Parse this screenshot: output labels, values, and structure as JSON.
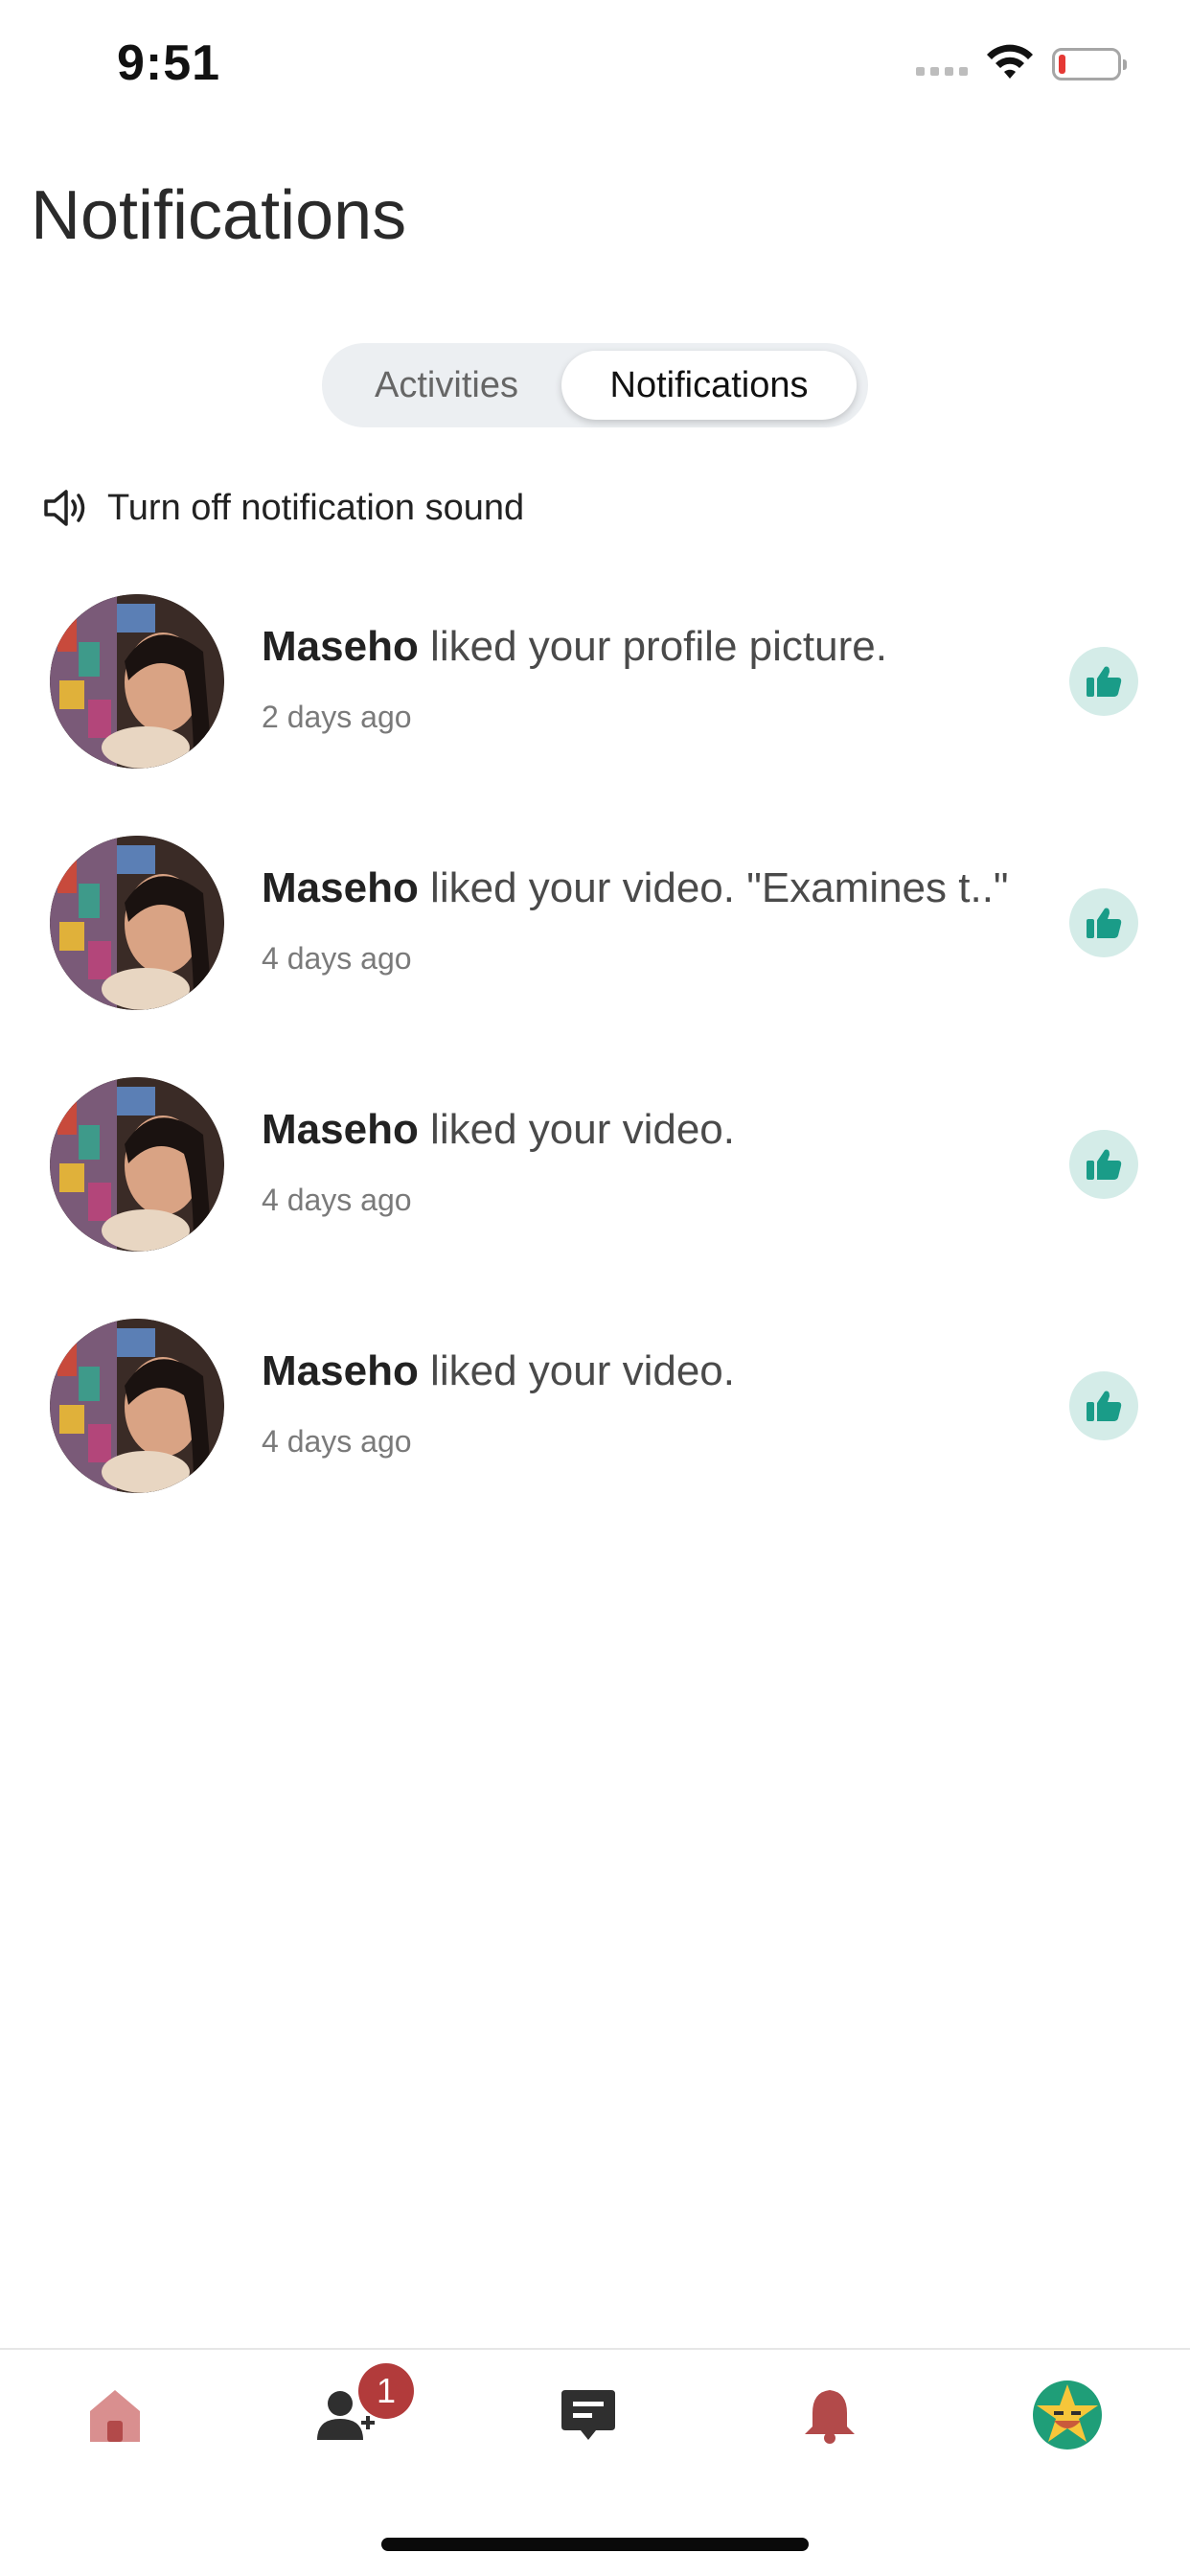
{
  "status_bar": {
    "time": "9:51",
    "battery_level": 0.12,
    "battery_color": "#e53935"
  },
  "header": {
    "title": "Notifications"
  },
  "tabs": {
    "items": [
      "Activities",
      "Notifications"
    ],
    "selected": "Notifications"
  },
  "sound_toggle": {
    "label": "Turn off notification sound",
    "icon": "speaker-icon"
  },
  "notifications": [
    {
      "name": "Maseho",
      "message": " liked your profile picture.",
      "time": "2 days ago",
      "icon": "thumbs-up-icon"
    },
    {
      "name": "Maseho",
      "message": " liked your video. \"Examines t..\"",
      "time": "4 days ago",
      "icon": "thumbs-up-icon"
    },
    {
      "name": "Maseho",
      "message": " liked your video.",
      "time": "4 days ago",
      "icon": "thumbs-up-icon"
    },
    {
      "name": "Maseho",
      "message": " liked your video.",
      "time": "4 days ago",
      "icon": "thumbs-up-icon"
    }
  ],
  "bottom_nav": {
    "items": [
      "home-icon",
      "friends-icon",
      "messages-icon",
      "bell-icon",
      "profile-avatar"
    ],
    "friends_badge": "1"
  },
  "colors": {
    "accent": "#1a9c88",
    "like_badge_bg": "#d4ece8",
    "nav_icon": "#b24a4a",
    "badge": "#b23b3b"
  }
}
